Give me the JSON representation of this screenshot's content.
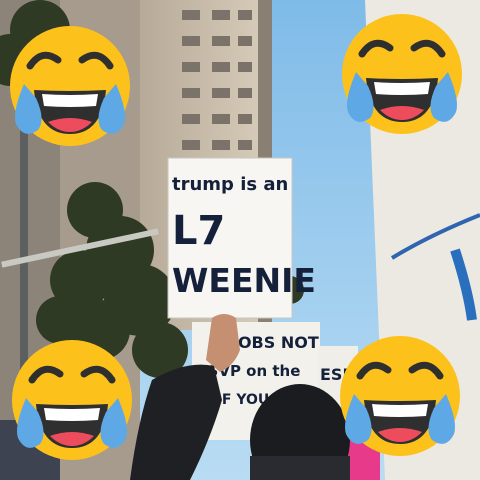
{
  "main_sign": {
    "line1": "trump is an",
    "line2": "L7",
    "line3": "WEENIE"
  },
  "background_sign": {
    "line1": "JOBS NOT",
    "line2": "RSVP on the",
    "line3": "OF YOU"
  },
  "right_sign": {
    "text": "ESP"
  },
  "emoji": {
    "name": "face-with-tears-of-joy",
    "count": 4
  },
  "colors": {
    "sky": "#8ec3ea",
    "emoji_face": "#fcc21b",
    "tears": "#5fa8e6"
  }
}
